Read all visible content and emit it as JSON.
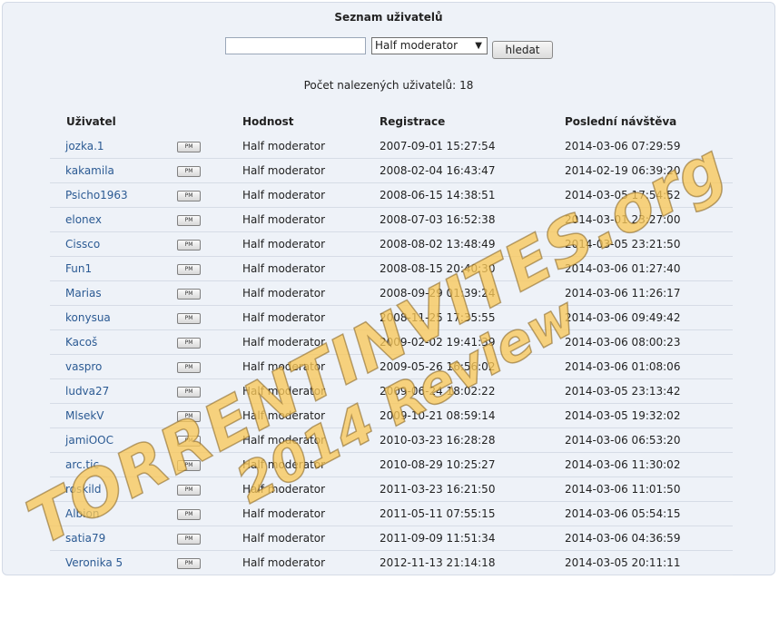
{
  "page": {
    "title": "Seznam uživatelů"
  },
  "search": {
    "input_value": "",
    "rank_selected": "Half moderator",
    "button_label": "hledat"
  },
  "result": {
    "count_label": "Počet nalezených uživatelů:",
    "count_value": "18"
  },
  "table": {
    "headers": {
      "user": "Uživatel",
      "rank": "Hodnost",
      "registration": "Registrace",
      "last_visit": "Poslední návštěva"
    },
    "pm_label": "PM",
    "rows": [
      {
        "user": "jozka.1",
        "rank": "Half moderator",
        "registered": "2007-09-01 15:27:54",
        "last_visit": "2014-03-06 07:29:59"
      },
      {
        "user": "kakamila",
        "rank": "Half moderator",
        "registered": "2008-02-04 16:43:47",
        "last_visit": "2014-02-19 06:39:20"
      },
      {
        "user": "Psicho1963",
        "rank": "Half moderator",
        "registered": "2008-06-15 14:38:51",
        "last_visit": "2014-03-05 17:54:52"
      },
      {
        "user": "elonex",
        "rank": "Half moderator",
        "registered": "2008-07-03 16:52:38",
        "last_visit": "2014-03-01 23:27:00"
      },
      {
        "user": "Cissco",
        "rank": "Half moderator",
        "registered": "2008-08-02 13:48:49",
        "last_visit": "2014-03-05 23:21:50"
      },
      {
        "user": "Fun1",
        "rank": "Half moderator",
        "registered": "2008-08-15 20:40:30",
        "last_visit": "2014-03-06 01:27:40"
      },
      {
        "user": "Marias",
        "rank": "Half moderator",
        "registered": "2008-09-29 01:39:24",
        "last_visit": "2014-03-06 11:26:17"
      },
      {
        "user": "konysua",
        "rank": "Half moderator",
        "registered": "2008-11-25 17:35:55",
        "last_visit": "2014-03-06 09:49:42"
      },
      {
        "user": "Kacoš",
        "rank": "Half moderator",
        "registered": "2009-02-02 19:41:39",
        "last_visit": "2014-03-06 08:00:23"
      },
      {
        "user": "vaspro",
        "rank": "Half moderator",
        "registered": "2009-05-26 16:56:02",
        "last_visit": "2014-03-06 01:08:06"
      },
      {
        "user": "ludva27",
        "rank": "Half moderator",
        "registered": "2009-06-24 18:02:22",
        "last_visit": "2014-03-05 23:13:42"
      },
      {
        "user": "MlsekV",
        "rank": "Half moderator",
        "registered": "2009-10-21 08:59:14",
        "last_visit": "2014-03-05 19:32:02"
      },
      {
        "user": "jamiOOC",
        "rank": "Half moderator",
        "registered": "2010-03-23 16:28:28",
        "last_visit": "2014-03-06 06:53:20"
      },
      {
        "user": "arc.tic",
        "rank": "Half moderator",
        "registered": "2010-08-29 10:25:27",
        "last_visit": "2014-03-06 11:30:02"
      },
      {
        "user": "roskild",
        "rank": "Half moderator",
        "registered": "2011-03-23 16:21:50",
        "last_visit": "2014-03-06 11:01:50"
      },
      {
        "user": "Albion",
        "rank": "Half moderator",
        "registered": "2011-05-11 07:55:15",
        "last_visit": "2014-03-06 05:54:15"
      },
      {
        "user": "satia79",
        "rank": "Half moderator",
        "registered": "2011-09-09 11:51:34",
        "last_visit": "2014-03-06 04:36:59"
      },
      {
        "user": "Veronika 5",
        "rank": "Half moderator",
        "registered": "2012-11-13 21:14:18",
        "last_visit": "2014-03-05 20:11:11"
      }
    ]
  },
  "watermark": {
    "line1": "TORRENTINVITES.org",
    "line2": "2014 Review"
  },
  "colors": {
    "link": "#2b5a93",
    "panel_bg": "#eef2f8",
    "watermark": "#f8c85a"
  }
}
